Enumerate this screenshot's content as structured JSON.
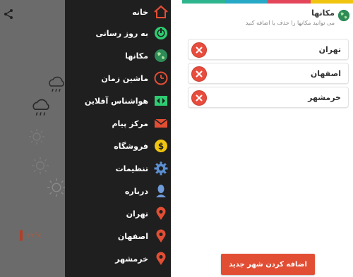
{
  "drawer": {
    "items": [
      {
        "label": "خانه",
        "icon": "home-icon"
      },
      {
        "label": "به روز رسانی",
        "icon": "power-refresh-icon"
      },
      {
        "label": "مکانها",
        "icon": "globe-icon"
      },
      {
        "label": "ماشین زمان",
        "icon": "clock-icon"
      },
      {
        "label": "هواشناس آفلاین",
        "icon": "offline-forecast-icon"
      },
      {
        "label": "مرکز پیام",
        "icon": "mail-icon"
      },
      {
        "label": "فروشگاه",
        "icon": "dollar-icon"
      },
      {
        "label": "تنظیمات",
        "icon": "gear-icon"
      },
      {
        "label": "درباره",
        "icon": "person-icon"
      },
      {
        "label": "تهران",
        "icon": "location-pin-icon"
      },
      {
        "label": "اصفهان",
        "icon": "location-pin-icon"
      },
      {
        "label": "خرمشهر",
        "icon": "location-pin-icon"
      }
    ]
  },
  "background": {
    "temperature": "۲۲°c"
  },
  "places": {
    "title": "مکانها",
    "subtitle": "می توانید مکانها را حذف یا اضافه کنید",
    "cities": [
      {
        "name": "تهران"
      },
      {
        "name": "اصفهان"
      },
      {
        "name": "خرمشهر"
      }
    ],
    "add_button": "اضافه کردن شهر جدید"
  },
  "colors": {
    "accent_red": "#e24e34",
    "delete_red": "#e84c3d",
    "drawer_bg": "#1f1f1f",
    "strip": [
      "#2fb58e",
      "#27a8c6",
      "#e3465a",
      "#f1c40f"
    ]
  }
}
